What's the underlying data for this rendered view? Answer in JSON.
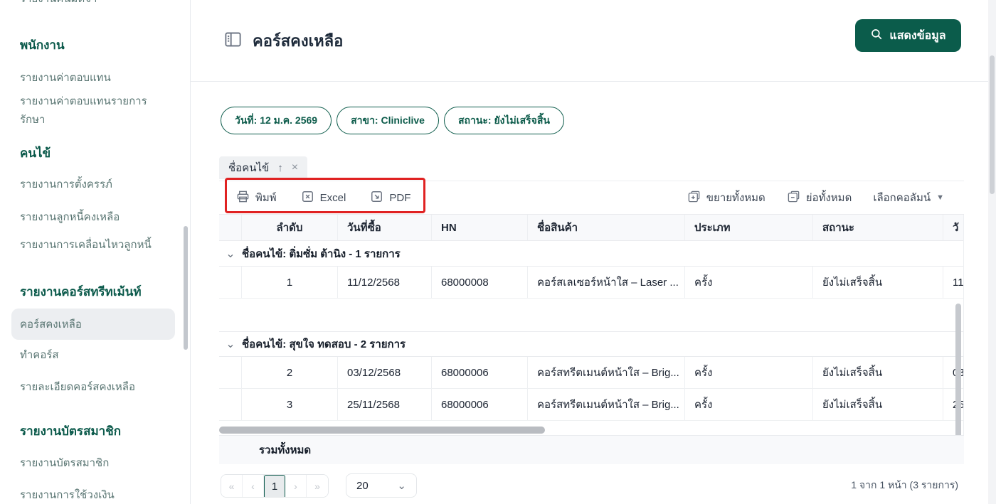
{
  "app": {
    "accent_green": "#0b5c4b",
    "annotation_red": "#e02222"
  },
  "sidebar": {
    "top_clipped_item": "รายงานคืนมัดจำ",
    "sections": [
      {
        "heading": "พนักงาน",
        "items": [
          "รายงานค่าตอบแทน",
          "รายงานค่าตอบแทนรายการรักษา"
        ]
      },
      {
        "heading": "คนไข้",
        "items": [
          "รายงานการตั้งครรภ์",
          "รายงานลูกหนี้คงเหลือ",
          "รายงานการเคลื่อนไหวลูกหนี้"
        ]
      },
      {
        "heading": "รายงานคอร์สทรีทเม้นท์",
        "items": [
          "คอร์สคงเหลือ",
          "ทำคอร์ส",
          "รายละเอียดคอร์สคงเหลือ"
        ],
        "active_item": "คอร์สคงเหลือ"
      },
      {
        "heading": "รายงานบัตรสมาชิก",
        "items": [
          "รายงานบัตรสมาชิก",
          "รายงานการใช้วงเงิน"
        ]
      }
    ]
  },
  "header": {
    "title": "คอร์สคงเหลือ",
    "show_data_button": "แสดงข้อมูล"
  },
  "filters": [
    {
      "label": "วันที่: 12 ม.ค. 2569"
    },
    {
      "label": "สาขา: Cliniclive"
    },
    {
      "label": "สถานะ: ยังไม่เสร็จสิ้น"
    }
  ],
  "grouping": {
    "tag": "ชื่อคนไข้",
    "sort_arrow": "↑",
    "close": "×"
  },
  "toolbar": {
    "print": "พิมพ์",
    "excel": "Excel",
    "pdf": "PDF",
    "expand_all": "ขยายทั้งหมด",
    "collapse_all": "ย่อทั้งหมด",
    "choose_columns": "เลือกคอลัมน์",
    "dropdown_arrow": "▼"
  },
  "table": {
    "headers": [
      "ลำดับ",
      "วันที่ซื้อ",
      "HN",
      "ชื่อสินค้า",
      "ประเภท",
      "สถานะ",
      "วั"
    ],
    "group_chevron": "⌄",
    "groups": [
      {
        "label": "ชื่อคนไข้:  ติ่มซั่ม ต้านิง - 1 รายการ",
        "rows": [
          {
            "seq": "1",
            "date": "11/12/2568",
            "hn": "68000008",
            "product": "คอร์สเลเซอร์หน้าใส – Laser ...",
            "type": "ครั้ง",
            "status": "ยังไม่เสร็จสิ้น",
            "cut": "11"
          }
        ]
      },
      {
        "label": "ชื่อคนไข้:  สุขใจ ทดสอบ - 2 รายการ",
        "rows": [
          {
            "seq": "2",
            "date": "03/12/2568",
            "hn": "68000006",
            "product": "คอร์สทรีตเมนต์หน้าใส – Brig...",
            "type": "ครั้ง",
            "status": "ยังไม่เสร็จสิ้น",
            "cut": "03"
          },
          {
            "seq": "3",
            "date": "25/11/2568",
            "hn": "68000006",
            "product": "คอร์สทรีตเมนต์หน้าใส – Brig...",
            "type": "ครั้ง",
            "status": "ยังไม่เสร็จสิ้น",
            "cut": "25"
          }
        ]
      }
    ],
    "summary": "รวมทั้งหมด"
  },
  "pagination": {
    "first": "«",
    "prev": "‹",
    "page": "1",
    "next": "›",
    "last": "»",
    "page_size": "20",
    "select_chevron": "⌄",
    "info": "1 จาก 1 หน้า (3 รายการ)"
  }
}
